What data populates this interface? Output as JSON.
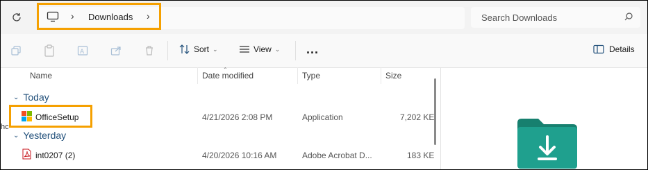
{
  "address_bar": {
    "breadcrumb": [
      "Downloads"
    ],
    "search_placeholder": "Search Downloads"
  },
  "toolbar": {
    "sort_label": "Sort",
    "view_label": "View",
    "more_label": "...",
    "details_label": "Details"
  },
  "columns": {
    "name": "Name",
    "date_modified": "Date modified",
    "type": "Type",
    "size": "Size"
  },
  "groups": [
    {
      "label": "Today",
      "files": [
        {
          "name": "OfficeSetup",
          "date": "4/21/2026 2:08 PM",
          "type": "Application",
          "size": "7,202 KE",
          "icon": "microsoft-logo-icon"
        }
      ]
    },
    {
      "label": "Yesterday",
      "files": [
        {
          "name": "int0207 (2)",
          "date": "4/20/2026 10:16 AM",
          "type": "Adobe Acrobat D...",
          "size": "183 KE",
          "icon": "pdf-icon"
        }
      ]
    }
  ],
  "left_clip_text": "hc",
  "colors": {
    "highlight": "#f5a000",
    "group_text": "#1f4e79",
    "folder": "#1f9e8c"
  }
}
